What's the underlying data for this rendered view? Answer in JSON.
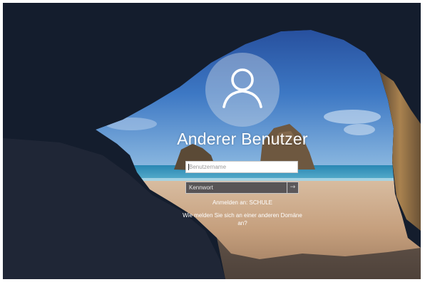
{
  "login": {
    "user_name": "Anderer Benutzer",
    "username_placeholder": "Benutzername",
    "password_placeholder": "Kennwort",
    "submit_arrow": "→",
    "sign_in_to": "Anmelden an: SCHULE",
    "other_domain_link": "Wie melden Sie sich an einer anderen Domäne an?"
  },
  "icons": {
    "avatar": "user-silhouette-icon",
    "submit": "arrow-right-icon"
  },
  "colors": {
    "sky": "#3d78c4",
    "sea": "#2d8fb8",
    "sand": "#c9a786",
    "cave": "#1a2233",
    "rock": "#a17c52"
  }
}
